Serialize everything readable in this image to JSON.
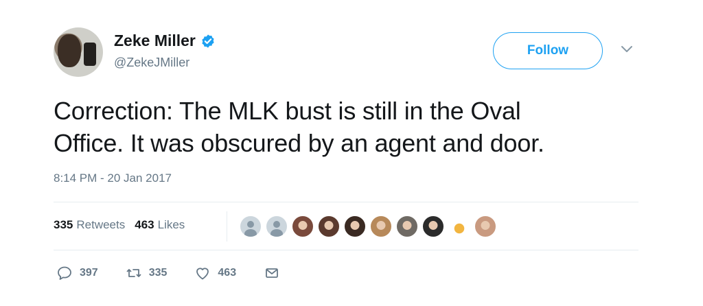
{
  "author": {
    "display_name": "Zeke Miller",
    "handle": "@ZekeJMiller",
    "verified": true
  },
  "follow_button": {
    "label": "Follow"
  },
  "tweet": {
    "line1": "Correction: The MLK bust is still in the Oval",
    "line2": "Office. It was obscured by an agent and door."
  },
  "timestamp": "8:14 PM - 20 Jan 2017",
  "stats": {
    "retweets_count": "335",
    "retweets_label": "Retweets",
    "likes_count": "463",
    "likes_label": "Likes"
  },
  "likers": [
    {
      "kind": "default",
      "color": "#ccd6dd"
    },
    {
      "kind": "default",
      "color": "#ccd6dd"
    },
    {
      "kind": "photo",
      "color": "#7a4a3c"
    },
    {
      "kind": "photo",
      "color": "#5b3a2e"
    },
    {
      "kind": "photo",
      "color": "#3a2a22"
    },
    {
      "kind": "photo",
      "color": "#b7895a"
    },
    {
      "kind": "photo",
      "color": "#6f6a64"
    },
    {
      "kind": "photo",
      "color": "#2b2b2b"
    },
    {
      "kind": "logo",
      "color": "#f2b540"
    },
    {
      "kind": "photo",
      "color": "#c99a80"
    }
  ],
  "actions": {
    "reply_count": "397",
    "retweet_count": "335",
    "like_count": "463"
  },
  "colors": {
    "accent": "#1da1f2",
    "text": "#14171a",
    "muted": "#657786",
    "divider": "#e6ecf0"
  },
  "icons": [
    "verified-badge-icon",
    "chevron-down-icon",
    "reply-icon",
    "retweet-icon",
    "like-icon",
    "direct-message-icon"
  ]
}
